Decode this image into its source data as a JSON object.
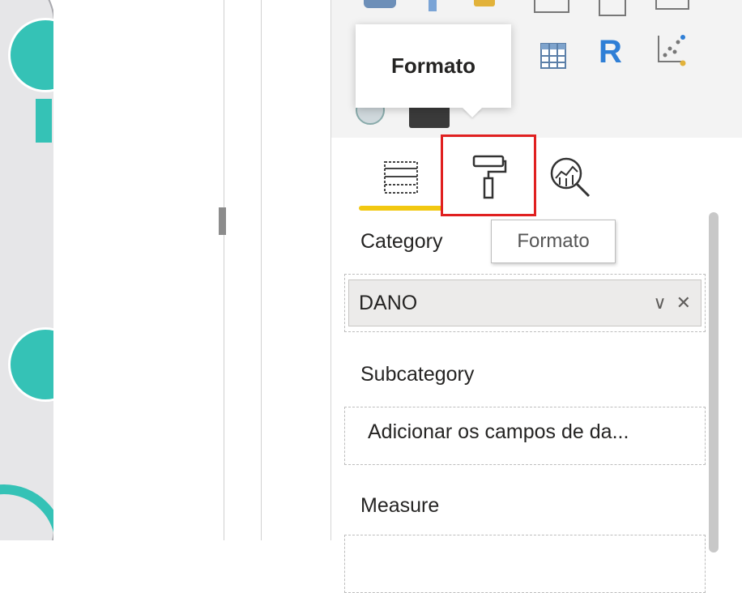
{
  "tooltips": {
    "header": "Formato",
    "hover": "Formato"
  },
  "tabs": {
    "fields_icon": "fields-icon",
    "format_icon": "paint-roller-icon",
    "analytics_icon": "magnifier-analytics-icon",
    "active_underline_color": "#f2c811",
    "highlight_color": "#e02020"
  },
  "visuals": {
    "r_script_letter": "R",
    "icons": [
      "table-icon",
      "r-script-icon",
      "python-scatter-icon",
      "globe-map-icon",
      "dark-card-icon"
    ]
  },
  "wells": {
    "category": {
      "label": "Category",
      "field": "DANO",
      "expand_icon": "∨",
      "remove_icon": "✕"
    },
    "subcategory": {
      "label": "Subcategory",
      "placeholder": "Adicionar os campos de da..."
    },
    "measure": {
      "label": "Measure"
    }
  },
  "colors": {
    "teal": "#35c2b6",
    "r_blue": "#2f7fd6"
  }
}
